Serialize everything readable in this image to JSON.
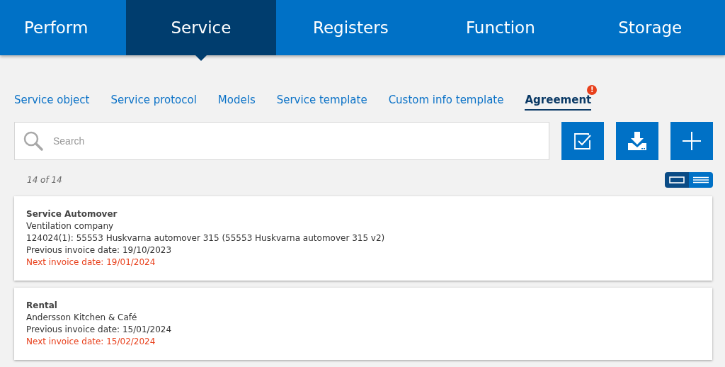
{
  "nav": [
    {
      "label": "Perform",
      "selected": false
    },
    {
      "label": "Service",
      "selected": true
    },
    {
      "label": "Registers",
      "selected": false
    },
    {
      "label": "Function",
      "selected": false
    },
    {
      "label": "Storage",
      "selected": false
    }
  ],
  "subtabs": [
    {
      "label": "Service object",
      "selected": false,
      "alert": false
    },
    {
      "label": "Service protocol",
      "selected": false,
      "alert": false
    },
    {
      "label": "Models",
      "selected": false,
      "alert": false
    },
    {
      "label": "Service template",
      "selected": false,
      "alert": false
    },
    {
      "label": "Custom info template",
      "selected": false,
      "alert": false
    },
    {
      "label": "Agreement",
      "selected": true,
      "alert": true,
      "badge": "!"
    }
  ],
  "search": {
    "placeholder": "Search"
  },
  "actions": [
    {
      "kind": "check"
    },
    {
      "kind": "download"
    },
    {
      "kind": "add"
    }
  ],
  "count": "14 of 14",
  "view_toggle": [
    {
      "kind": "cards",
      "selected": true
    },
    {
      "kind": "list",
      "selected": false
    }
  ],
  "cards": [
    {
      "lines": [
        {
          "kind": "title",
          "text": "Service Automover"
        },
        {
          "kind": "text",
          "text": "Ventilation company"
        },
        {
          "kind": "text",
          "text": "124024(1): 55553 Huskvarna automover 315 (55553 Huskvarna automover 315 v2)"
        },
        {
          "kind": "text",
          "text": "Previous invoice date: 19/10/2023"
        },
        {
          "kind": "due",
          "text": "Next invoice date: 19/01/2024"
        }
      ]
    },
    {
      "lines": [
        {
          "kind": "title",
          "text": "Rental"
        },
        {
          "kind": "text",
          "text": "Andersson Kitchen & Café"
        },
        {
          "kind": "text",
          "text": "Previous invoice date: 15/01/2024"
        },
        {
          "kind": "due",
          "text": "Next invoice date: 15/02/2024"
        }
      ]
    }
  ]
}
